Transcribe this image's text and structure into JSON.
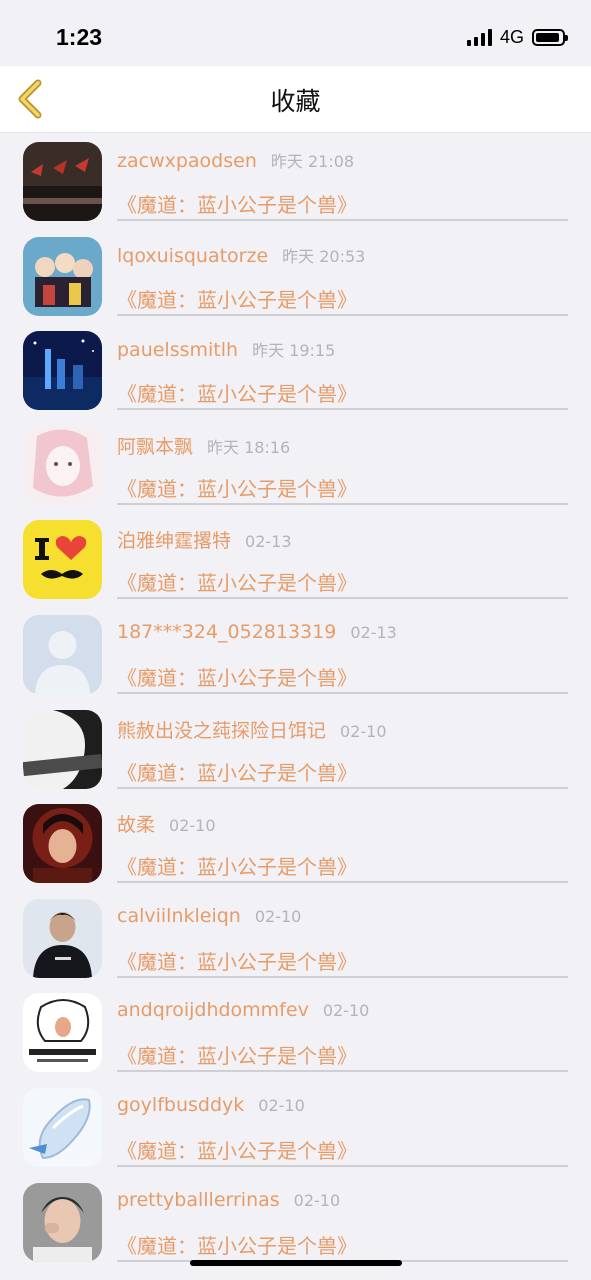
{
  "status": {
    "time": "1:23",
    "network": "4G"
  },
  "nav": {
    "title": "收藏",
    "back_icon": "chevron-left-icon",
    "accent": "#d8b440"
  },
  "colors": {
    "accent_text": "#e79c68",
    "muted": "#b5b3b8"
  },
  "items": [
    {
      "user": "zacwxpaodsen",
      "time": "昨天 21:08",
      "book": "《魔道：蓝小公子是个兽》"
    },
    {
      "user": "lqoxuisquatorze",
      "time": "昨天 20:53",
      "book": "《魔道：蓝小公子是个兽》"
    },
    {
      "user": "pauelssmitlh",
      "time": "昨天 19:15",
      "book": "《魔道：蓝小公子是个兽》"
    },
    {
      "user": "阿飘本飘",
      "time": "昨天 18:16",
      "book": "《魔道：蓝小公子是个兽》"
    },
    {
      "user": "泊雅绅霆撂特",
      "time": "02-13",
      "book": "《魔道：蓝小公子是个兽》"
    },
    {
      "user": "187***324_052813319",
      "time": "02-13",
      "book": "《魔道：蓝小公子是个兽》"
    },
    {
      "user": "熊赦出没之莼探险日饵记",
      "time": "02-10",
      "book": "《魔道：蓝小公子是个兽》"
    },
    {
      "user": "故柔",
      "time": "02-10",
      "book": "《魔道：蓝小公子是个兽》"
    },
    {
      "user": "calviilnkleiqn",
      "time": "02-10",
      "book": "《魔道：蓝小公子是个兽》"
    },
    {
      "user": "andqroijdhdommfev",
      "time": "02-10",
      "book": "《魔道：蓝小公子是个兽》"
    },
    {
      "user": "goylfbusddyk",
      "time": "02-10",
      "book": "《魔道：蓝小公子是个兽》"
    },
    {
      "user": "prettyballlerrinas",
      "time": "02-10",
      "book": "《魔道：蓝小公子是个兽》"
    }
  ]
}
